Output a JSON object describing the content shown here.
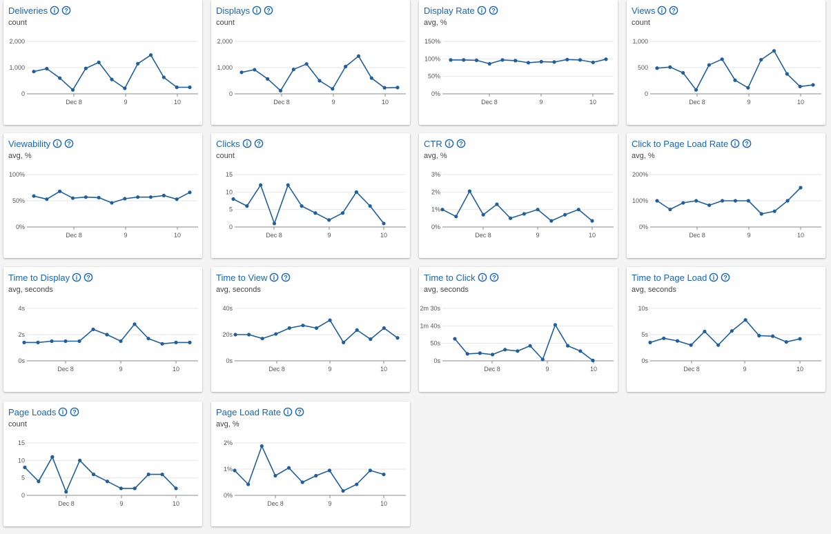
{
  "icons": {
    "info": "info-circle-icon",
    "help": "help-circle-icon"
  },
  "colors": {
    "title": "#1565c0",
    "line": "#1f5f9e",
    "grid": "#e6e6e6"
  },
  "x_ticks": [
    "Dec 8",
    "9",
    "10"
  ],
  "cards": [
    {
      "title": "Deliveries",
      "subtitle": "count"
    },
    {
      "title": "Displays",
      "subtitle": "count"
    },
    {
      "title": "Display Rate",
      "subtitle": "avg, %"
    },
    {
      "title": "Views",
      "subtitle": "count"
    },
    {
      "title": "Viewability",
      "subtitle": "avg, %"
    },
    {
      "title": "Clicks",
      "subtitle": "count"
    },
    {
      "title": "CTR",
      "subtitle": "avg, %"
    },
    {
      "title": "Click to Page Load Rate",
      "subtitle": "avg, %"
    },
    {
      "title": "Time to Display",
      "subtitle": "avg, seconds"
    },
    {
      "title": "Time to View",
      "subtitle": "avg, seconds"
    },
    {
      "title": "Time to Click",
      "subtitle": "avg, seconds"
    },
    {
      "title": "Time to Page Load",
      "subtitle": "avg, seconds"
    },
    {
      "title": "Page Loads",
      "subtitle": "count"
    },
    {
      "title": "Page Load Rate",
      "subtitle": "avg, %"
    }
  ],
  "chart_data": [
    {
      "type": "line",
      "title": "Deliveries",
      "x": [
        0,
        1,
        2,
        3,
        4,
        5,
        6,
        7,
        8,
        9,
        10,
        11,
        12
      ],
      "y_ticks": [
        "0",
        "1,000",
        "2,000"
      ],
      "ylim": [
        0,
        2000
      ],
      "grid": true,
      "series": [
        {
          "values": [
            850,
            960,
            600,
            150,
            970,
            1200,
            550,
            210,
            1150,
            1480,
            630,
            250,
            250
          ]
        }
      ]
    },
    {
      "type": "line",
      "title": "Displays",
      "x": [
        0,
        1,
        2,
        3,
        4,
        5,
        6,
        7,
        8,
        9,
        10,
        11,
        12
      ],
      "y_ticks": [
        "0",
        "1,000",
        "2,000"
      ],
      "ylim": [
        0,
        2000
      ],
      "grid": true,
      "series": [
        {
          "values": [
            820,
            920,
            570,
            120,
            930,
            1140,
            500,
            190,
            1040,
            1440,
            600,
            230,
            240
          ]
        }
      ]
    },
    {
      "type": "line",
      "title": "Display Rate",
      "x": [
        0,
        1,
        2,
        3,
        4,
        5,
        6,
        7,
        8,
        9,
        10,
        11,
        12
      ],
      "y_ticks": [
        "0%",
        "50%",
        "100%",
        "150%"
      ],
      "ylim": [
        0,
        150
      ],
      "grid": true,
      "series": [
        {
          "values": [
            97,
            97,
            96,
            86,
            97,
            95,
            89,
            92,
            91,
            98,
            97,
            90,
            99
          ]
        }
      ]
    },
    {
      "type": "line",
      "title": "Views",
      "x": [
        0,
        1,
        2,
        3,
        4,
        5,
        6,
        7,
        8,
        9,
        10,
        11,
        12
      ],
      "y_ticks": [
        "0",
        "500",
        "1,000"
      ],
      "ylim": [
        0,
        1000
      ],
      "grid": true,
      "series": [
        {
          "values": [
            490,
            510,
            400,
            75,
            550,
            660,
            260,
            115,
            650,
            820,
            380,
            140,
            170
          ]
        }
      ]
    },
    {
      "type": "line",
      "title": "Viewability",
      "x": [
        0,
        1,
        2,
        3,
        4,
        5,
        6,
        7,
        8,
        9,
        10,
        11,
        12
      ],
      "y_ticks": [
        "0%",
        "50%",
        "100%"
      ],
      "ylim": [
        0,
        100
      ],
      "grid": true,
      "series": [
        {
          "values": [
            59,
            53,
            68,
            55,
            57,
            56,
            46,
            54,
            57,
            57,
            60,
            53,
            66
          ]
        }
      ]
    },
    {
      "type": "line",
      "title": "Clicks",
      "x": [
        0,
        1,
        2,
        3,
        4,
        5,
        6,
        7,
        8,
        9,
        10,
        11
      ],
      "y_ticks": [
        "0",
        "5",
        "10",
        "15"
      ],
      "ylim": [
        0,
        15
      ],
      "grid": true,
      "series": [
        {
          "values": [
            8,
            6,
            12,
            1,
            12,
            6,
            4,
            2,
            4,
            10,
            6,
            1
          ]
        }
      ]
    },
    {
      "type": "line",
      "title": "CTR",
      "x": [
        0,
        1,
        2,
        3,
        4,
        5,
        6,
        7,
        8,
        9,
        10,
        11
      ],
      "y_ticks": [
        "0%",
        "1%",
        "2%",
        "3%"
      ],
      "ylim": [
        0,
        3
      ],
      "grid": true,
      "series": [
        {
          "values": [
            1.0,
            0.6,
            2.05,
            0.7,
            1.3,
            0.5,
            0.75,
            1.0,
            0.35,
            0.7,
            1.0,
            0.35
          ]
        }
      ]
    },
    {
      "type": "line",
      "title": "Click to Page Load Rate",
      "x": [
        0,
        1,
        2,
        3,
        4,
        5,
        6,
        7,
        8,
        9,
        10,
        11
      ],
      "y_ticks": [
        "0%",
        "100%",
        "200%"
      ],
      "ylim": [
        0,
        200
      ],
      "grid": true,
      "series": [
        {
          "values": [
            100,
            67,
            92,
            100,
            83,
            100,
            100,
            100,
            50,
            60,
            100,
            150
          ]
        }
      ]
    },
    {
      "type": "line",
      "title": "Time to Display",
      "x": [
        0,
        1,
        2,
        3,
        4,
        5,
        6,
        7,
        8,
        9,
        10,
        11,
        12
      ],
      "y_ticks": [
        "0s",
        "2s",
        "4s"
      ],
      "ylim": [
        0,
        4
      ],
      "grid": true,
      "series": [
        {
          "values": [
            1.4,
            1.4,
            1.5,
            1.5,
            1.5,
            2.4,
            2.0,
            1.5,
            2.8,
            1.7,
            1.3,
            1.4,
            1.4
          ]
        }
      ]
    },
    {
      "type": "line",
      "title": "Time to View",
      "x": [
        0,
        1,
        2,
        3,
        4,
        5,
        6,
        7,
        8,
        9,
        10,
        11,
        12
      ],
      "y_ticks": [
        "0s",
        "20s",
        "40s"
      ],
      "ylim": [
        0,
        40
      ],
      "grid": true,
      "series": [
        {
          "values": [
            20,
            20,
            17,
            20.5,
            25,
            27,
            25,
            31,
            14,
            23.5,
            16.5,
            25,
            17.5
          ]
        }
      ]
    },
    {
      "type": "line",
      "title": "Time to Click",
      "x": [
        0,
        1,
        2,
        3,
        4,
        5,
        6,
        7,
        8,
        9,
        10,
        11
      ],
      "y_ticks": [
        "0s",
        "50s",
        "1m 40s",
        "2m 30s"
      ],
      "ylim": [
        0,
        150
      ],
      "grid": true,
      "series": [
        {
          "values": [
            63,
            20,
            22,
            18,
            32,
            28,
            43,
            4,
            103,
            43,
            28,
            1
          ]
        }
      ]
    },
    {
      "type": "line",
      "title": "Time to Page Load",
      "x": [
        0,
        1,
        2,
        3,
        4,
        5,
        6,
        7,
        8,
        9,
        10,
        11
      ],
      "y_ticks": [
        "0s",
        "5s",
        "10s"
      ],
      "ylim": [
        0,
        10
      ],
      "grid": true,
      "series": [
        {
          "values": [
            3.5,
            4.3,
            3.8,
            3.0,
            5.6,
            3.0,
            5.7,
            7.8,
            4.8,
            4.7,
            3.6,
            4.2
          ]
        }
      ]
    },
    {
      "type": "line",
      "title": "Page Loads",
      "x": [
        0,
        1,
        2,
        3,
        4,
        5,
        6,
        7,
        8,
        9,
        10,
        11
      ],
      "y_ticks": [
        "0",
        "5",
        "10",
        "15"
      ],
      "ylim": [
        0,
        15
      ],
      "grid": true,
      "series": [
        {
          "values": [
            8,
            4,
            11,
            1,
            10,
            6,
            4,
            2,
            2,
            6,
            6,
            2
          ]
        }
      ]
    },
    {
      "type": "line",
      "title": "Page Load Rate",
      "x": [
        0,
        1,
        2,
        3,
        4,
        5,
        6,
        7,
        8,
        9,
        10,
        11
      ],
      "y_ticks": [
        "0%",
        "1%",
        "2%"
      ],
      "ylim": [
        0,
        2
      ],
      "grid": true,
      "series": [
        {
          "values": [
            0.95,
            0.42,
            1.88,
            0.75,
            1.05,
            0.5,
            0.75,
            0.95,
            0.17,
            0.42,
            0.95,
            0.8
          ]
        }
      ]
    }
  ]
}
